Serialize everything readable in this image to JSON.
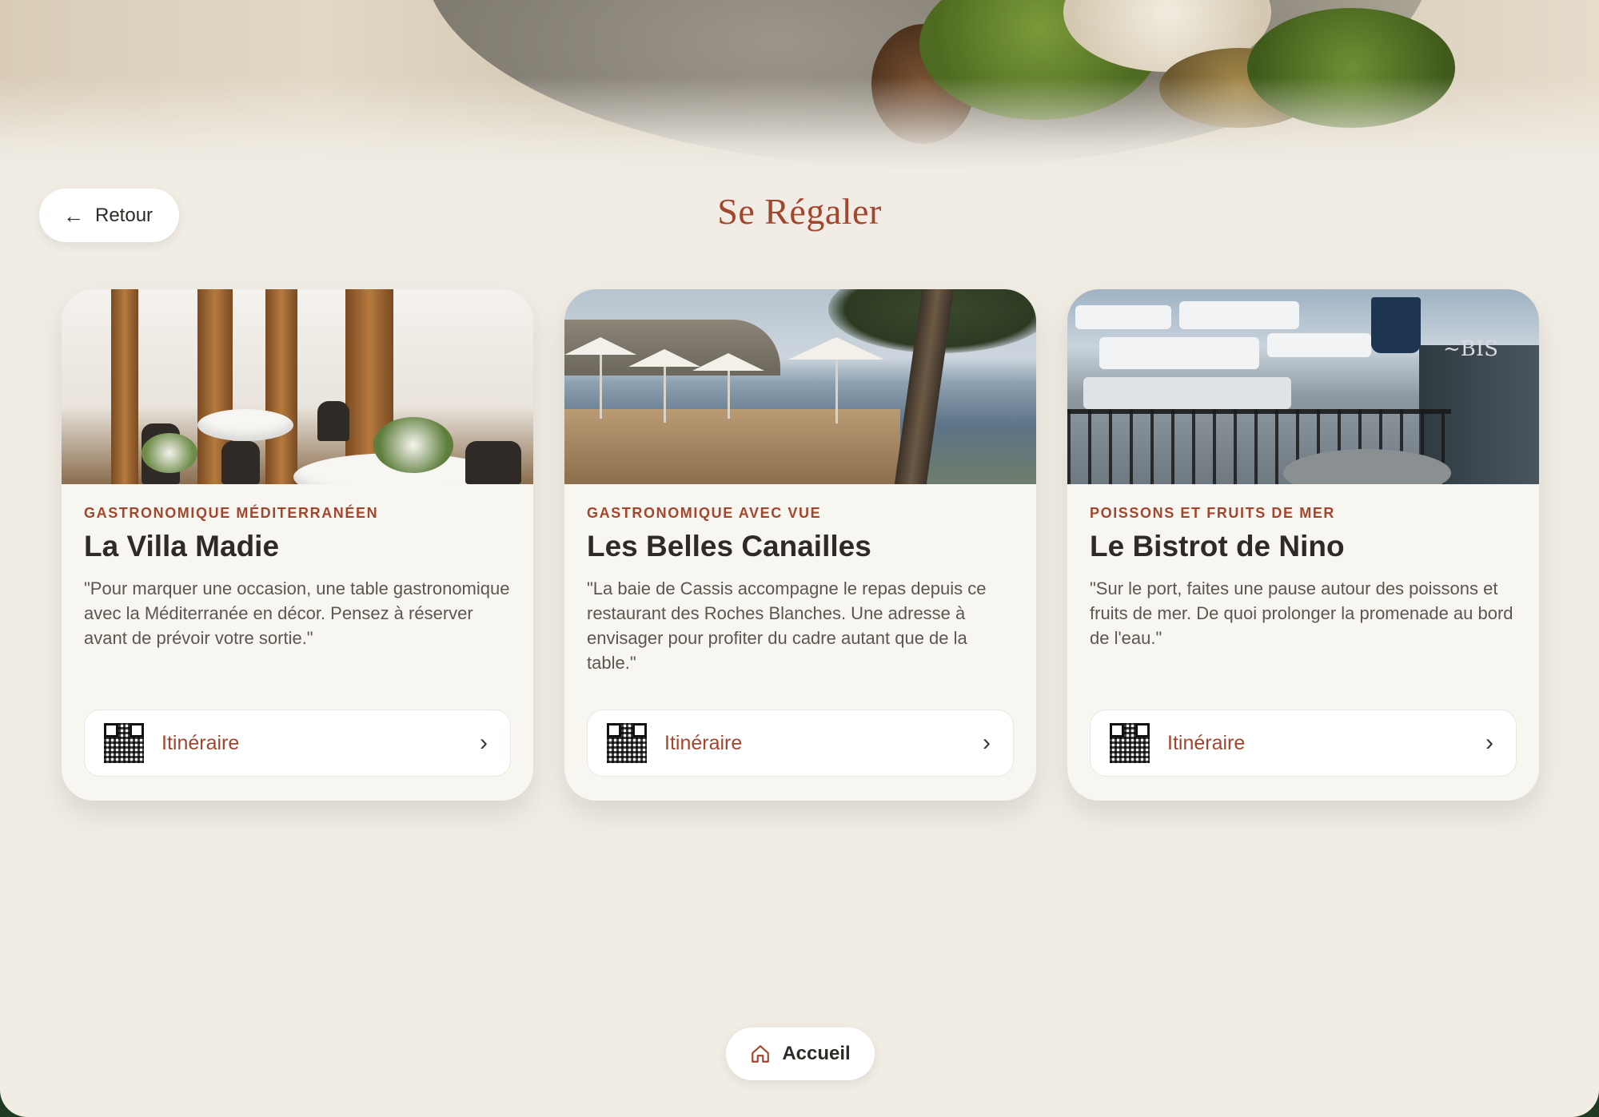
{
  "header": {
    "back_label": "Retour",
    "title": "Se Régaler"
  },
  "cards": [
    {
      "category": "GASTRONOMIQUE MÉDITERRANÉEN",
      "name": "La Villa Madie",
      "description": "\"Pour marquer une occasion, une table gastronomique avec la Méditerranée en décor. Pensez à réserver avant de prévoir votre sortie.\"",
      "itinerary_label": "Itinéraire"
    },
    {
      "category": "GASTRONOMIQUE AVEC VUE",
      "name": "Les Belles Canailles",
      "description": "\"La baie de Cassis accompagne le repas depuis ce restaurant des Roches Blanches. Une adresse à envisager pour profiter du cadre autant que de la table.\"",
      "itinerary_label": "Itinéraire"
    },
    {
      "category": "POISSONS ET FRUITS DE MER",
      "name": "Le Bistrot de Nino",
      "description": "\"Sur le port, faites une pause autour des poissons et fruits de mer. De quoi prolonger la promenade au bord de l'eau.\"",
      "itinerary_label": "Itinéraire"
    }
  ],
  "footer": {
    "home_label": "Accueil"
  },
  "icons": {
    "back": "arrow-left-icon",
    "qr": "qr-code-icon",
    "chevron": "chevron-right-icon",
    "home": "home-icon"
  },
  "colors": {
    "accent": "#a2462d",
    "background": "#f1ede5",
    "card": "#f8f6f1",
    "text": "#2e2b27"
  }
}
